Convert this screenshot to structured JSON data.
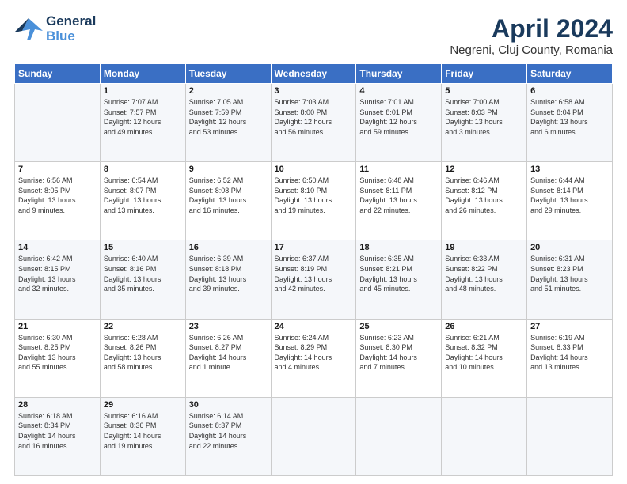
{
  "header": {
    "logo_general": "General",
    "logo_blue": "Blue",
    "month_title": "April 2024",
    "location": "Negreni, Cluj County, Romania"
  },
  "days_header": [
    "Sunday",
    "Monday",
    "Tuesday",
    "Wednesday",
    "Thursday",
    "Friday",
    "Saturday"
  ],
  "weeks": [
    [
      {
        "num": "",
        "lines": []
      },
      {
        "num": "1",
        "lines": [
          "Sunrise: 7:07 AM",
          "Sunset: 7:57 PM",
          "Daylight: 12 hours",
          "and 49 minutes."
        ]
      },
      {
        "num": "2",
        "lines": [
          "Sunrise: 7:05 AM",
          "Sunset: 7:59 PM",
          "Daylight: 12 hours",
          "and 53 minutes."
        ]
      },
      {
        "num": "3",
        "lines": [
          "Sunrise: 7:03 AM",
          "Sunset: 8:00 PM",
          "Daylight: 12 hours",
          "and 56 minutes."
        ]
      },
      {
        "num": "4",
        "lines": [
          "Sunrise: 7:01 AM",
          "Sunset: 8:01 PM",
          "Daylight: 12 hours",
          "and 59 minutes."
        ]
      },
      {
        "num": "5",
        "lines": [
          "Sunrise: 7:00 AM",
          "Sunset: 8:03 PM",
          "Daylight: 13 hours",
          "and 3 minutes."
        ]
      },
      {
        "num": "6",
        "lines": [
          "Sunrise: 6:58 AM",
          "Sunset: 8:04 PM",
          "Daylight: 13 hours",
          "and 6 minutes."
        ]
      }
    ],
    [
      {
        "num": "7",
        "lines": [
          "Sunrise: 6:56 AM",
          "Sunset: 8:05 PM",
          "Daylight: 13 hours",
          "and 9 minutes."
        ]
      },
      {
        "num": "8",
        "lines": [
          "Sunrise: 6:54 AM",
          "Sunset: 8:07 PM",
          "Daylight: 13 hours",
          "and 13 minutes."
        ]
      },
      {
        "num": "9",
        "lines": [
          "Sunrise: 6:52 AM",
          "Sunset: 8:08 PM",
          "Daylight: 13 hours",
          "and 16 minutes."
        ]
      },
      {
        "num": "10",
        "lines": [
          "Sunrise: 6:50 AM",
          "Sunset: 8:10 PM",
          "Daylight: 13 hours",
          "and 19 minutes."
        ]
      },
      {
        "num": "11",
        "lines": [
          "Sunrise: 6:48 AM",
          "Sunset: 8:11 PM",
          "Daylight: 13 hours",
          "and 22 minutes."
        ]
      },
      {
        "num": "12",
        "lines": [
          "Sunrise: 6:46 AM",
          "Sunset: 8:12 PM",
          "Daylight: 13 hours",
          "and 26 minutes."
        ]
      },
      {
        "num": "13",
        "lines": [
          "Sunrise: 6:44 AM",
          "Sunset: 8:14 PM",
          "Daylight: 13 hours",
          "and 29 minutes."
        ]
      }
    ],
    [
      {
        "num": "14",
        "lines": [
          "Sunrise: 6:42 AM",
          "Sunset: 8:15 PM",
          "Daylight: 13 hours",
          "and 32 minutes."
        ]
      },
      {
        "num": "15",
        "lines": [
          "Sunrise: 6:40 AM",
          "Sunset: 8:16 PM",
          "Daylight: 13 hours",
          "and 35 minutes."
        ]
      },
      {
        "num": "16",
        "lines": [
          "Sunrise: 6:39 AM",
          "Sunset: 8:18 PM",
          "Daylight: 13 hours",
          "and 39 minutes."
        ]
      },
      {
        "num": "17",
        "lines": [
          "Sunrise: 6:37 AM",
          "Sunset: 8:19 PM",
          "Daylight: 13 hours",
          "and 42 minutes."
        ]
      },
      {
        "num": "18",
        "lines": [
          "Sunrise: 6:35 AM",
          "Sunset: 8:21 PM",
          "Daylight: 13 hours",
          "and 45 minutes."
        ]
      },
      {
        "num": "19",
        "lines": [
          "Sunrise: 6:33 AM",
          "Sunset: 8:22 PM",
          "Daylight: 13 hours",
          "and 48 minutes."
        ]
      },
      {
        "num": "20",
        "lines": [
          "Sunrise: 6:31 AM",
          "Sunset: 8:23 PM",
          "Daylight: 13 hours",
          "and 51 minutes."
        ]
      }
    ],
    [
      {
        "num": "21",
        "lines": [
          "Sunrise: 6:30 AM",
          "Sunset: 8:25 PM",
          "Daylight: 13 hours",
          "and 55 minutes."
        ]
      },
      {
        "num": "22",
        "lines": [
          "Sunrise: 6:28 AM",
          "Sunset: 8:26 PM",
          "Daylight: 13 hours",
          "and 58 minutes."
        ]
      },
      {
        "num": "23",
        "lines": [
          "Sunrise: 6:26 AM",
          "Sunset: 8:27 PM",
          "Daylight: 14 hours",
          "and 1 minute."
        ]
      },
      {
        "num": "24",
        "lines": [
          "Sunrise: 6:24 AM",
          "Sunset: 8:29 PM",
          "Daylight: 14 hours",
          "and 4 minutes."
        ]
      },
      {
        "num": "25",
        "lines": [
          "Sunrise: 6:23 AM",
          "Sunset: 8:30 PM",
          "Daylight: 14 hours",
          "and 7 minutes."
        ]
      },
      {
        "num": "26",
        "lines": [
          "Sunrise: 6:21 AM",
          "Sunset: 8:32 PM",
          "Daylight: 14 hours",
          "and 10 minutes."
        ]
      },
      {
        "num": "27",
        "lines": [
          "Sunrise: 6:19 AM",
          "Sunset: 8:33 PM",
          "Daylight: 14 hours",
          "and 13 minutes."
        ]
      }
    ],
    [
      {
        "num": "28",
        "lines": [
          "Sunrise: 6:18 AM",
          "Sunset: 8:34 PM",
          "Daylight: 14 hours",
          "and 16 minutes."
        ]
      },
      {
        "num": "29",
        "lines": [
          "Sunrise: 6:16 AM",
          "Sunset: 8:36 PM",
          "Daylight: 14 hours",
          "and 19 minutes."
        ]
      },
      {
        "num": "30",
        "lines": [
          "Sunrise: 6:14 AM",
          "Sunset: 8:37 PM",
          "Daylight: 14 hours",
          "and 22 minutes."
        ]
      },
      {
        "num": "",
        "lines": []
      },
      {
        "num": "",
        "lines": []
      },
      {
        "num": "",
        "lines": []
      },
      {
        "num": "",
        "lines": []
      }
    ]
  ]
}
